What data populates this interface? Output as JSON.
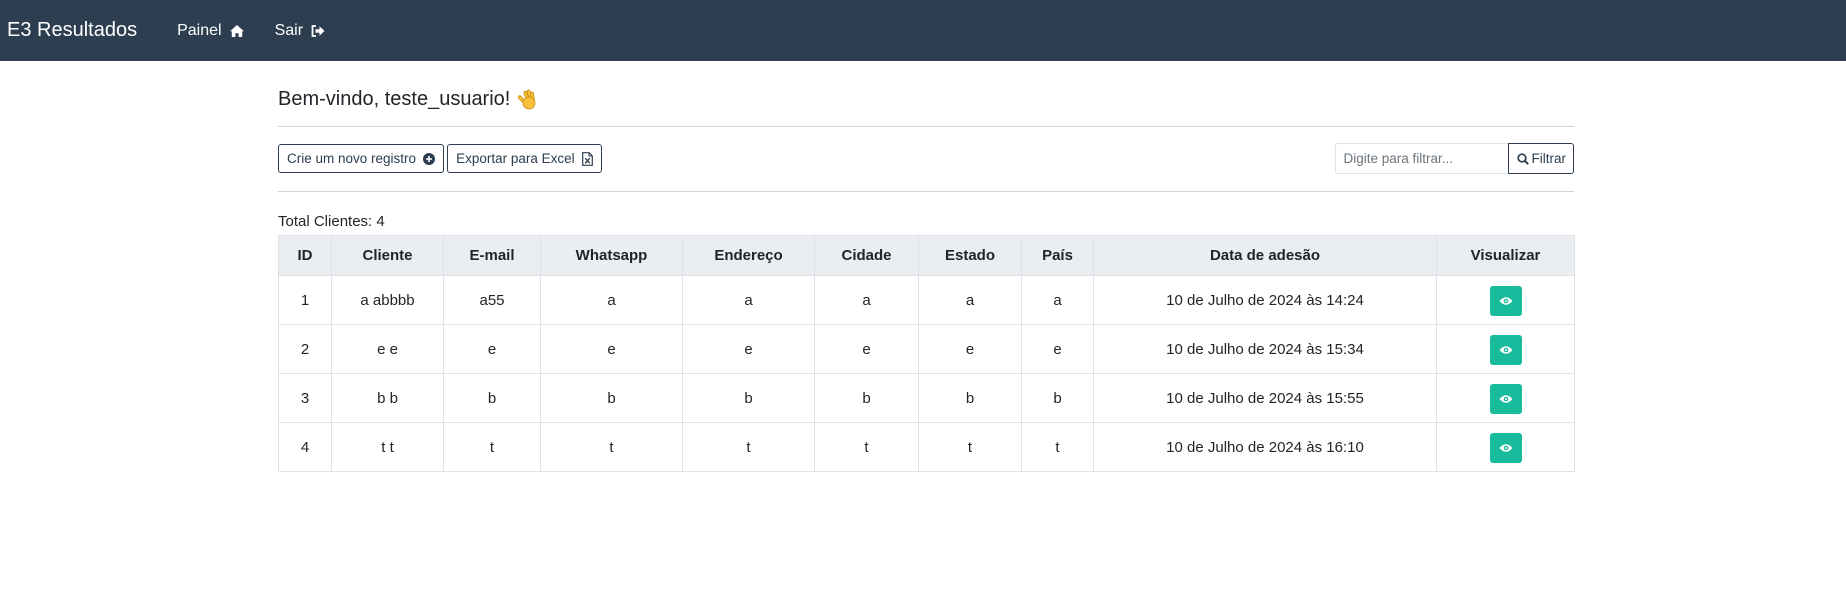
{
  "navbar": {
    "brand": "E3 Resultados",
    "items": [
      {
        "label": "Painel",
        "icon": "home-icon"
      },
      {
        "label": "Sair",
        "icon": "sign-out-icon"
      }
    ]
  },
  "welcome": "Bem-vindo, teste_usuario!",
  "toolbar": {
    "new_record_label": "Crie um novo registro",
    "export_label": "Exportar para Excel",
    "filter_placeholder": "Digite para filtrar...",
    "filter_label": "Filtrar"
  },
  "total": "Total Clientes: 4",
  "table": {
    "headers": [
      "ID",
      "Cliente",
      "E-mail",
      "Whatsapp",
      "Endereço",
      "Cidade",
      "Estado",
      "País",
      "Data de adesão",
      "Visualizar"
    ],
    "rows": [
      [
        "1",
        "a abbbb",
        "a55",
        "a",
        "a",
        "a",
        "a",
        "a",
        "10 de Julho de 2024 às 14:24"
      ],
      [
        "2",
        "e e",
        "e",
        "e",
        "e",
        "e",
        "e",
        "e",
        "10 de Julho de 2024 às 15:34"
      ],
      [
        "3",
        "b b",
        "b",
        "b",
        "b",
        "b",
        "b",
        "b",
        "10 de Julho de 2024 às 15:55"
      ],
      [
        "4",
        "t t",
        "t",
        "t",
        "t",
        "t",
        "t",
        "t",
        "10 de Julho de 2024 às 16:10"
      ]
    ]
  },
  "colors": {
    "navbar": "#2c3e50",
    "accent": "#18bc9c",
    "header_bg": "#ebeef0"
  }
}
